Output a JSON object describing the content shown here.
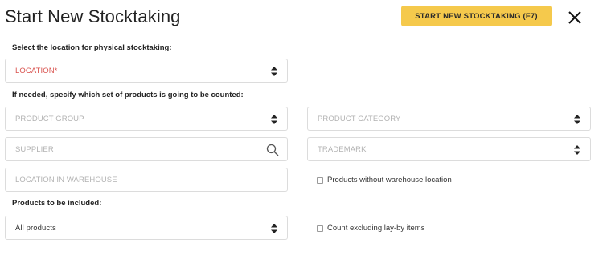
{
  "header": {
    "title": "Start New Stocktaking",
    "start_button": "START NEW STOCKTAKING (F7)"
  },
  "labels": {
    "location_prompt": "Select the location for physical stocktaking:",
    "products_prompt": "If needed, specify which set of products is going to be counted:",
    "included_prompt": "Products to be included:"
  },
  "fields": {
    "location": "LOCATION*",
    "product_group": "PRODUCT GROUP",
    "product_category": "PRODUCT CATEGORY",
    "supplier": "SUPPLIER",
    "trademark": "TRADEMARK",
    "location_in_warehouse": "LOCATION IN WAREHOUSE",
    "products_included": "All products"
  },
  "checkboxes": {
    "without_location": "Products without warehouse location",
    "excluding_layby": "Count excluding lay-by items"
  },
  "colors": {
    "accent": "#f5c94c",
    "required": "#d9534f"
  }
}
